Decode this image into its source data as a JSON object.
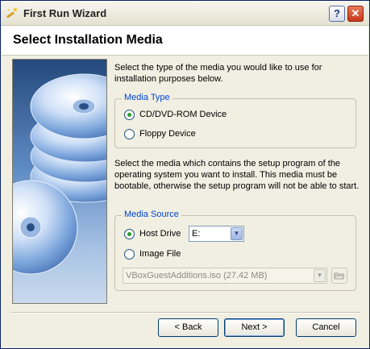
{
  "window": {
    "title": "First Run Wizard",
    "help_label": "?",
    "close_label": "✕"
  },
  "header": {
    "title": "Select Installation Media"
  },
  "intro_text": "Select the type of the media you would like to use for installation purposes below.",
  "media_type": {
    "legend": "Media Type",
    "options": [
      {
        "label": "CD/DVD-ROM Device",
        "checked": true
      },
      {
        "label": "Floppy Device",
        "checked": false
      }
    ]
  },
  "source_text": "Select the media which contains the setup program of the operating system you want to install. This media must be bootable, otherwise the setup program will not be able to start.",
  "media_source": {
    "legend": "Media Source",
    "host_drive_label": "Host Drive",
    "host_drive_value": "E:",
    "image_file_label": "Image File",
    "image_file_value": "VBoxGuestAdditions.iso (27.42 MB)"
  },
  "buttons": {
    "back": "< Back",
    "next": "Next >",
    "cancel": "Cancel"
  },
  "icons": {
    "title": "wizard-wand-icon",
    "folder": "folder-open-icon",
    "dropdown": "chevron-down-icon"
  }
}
